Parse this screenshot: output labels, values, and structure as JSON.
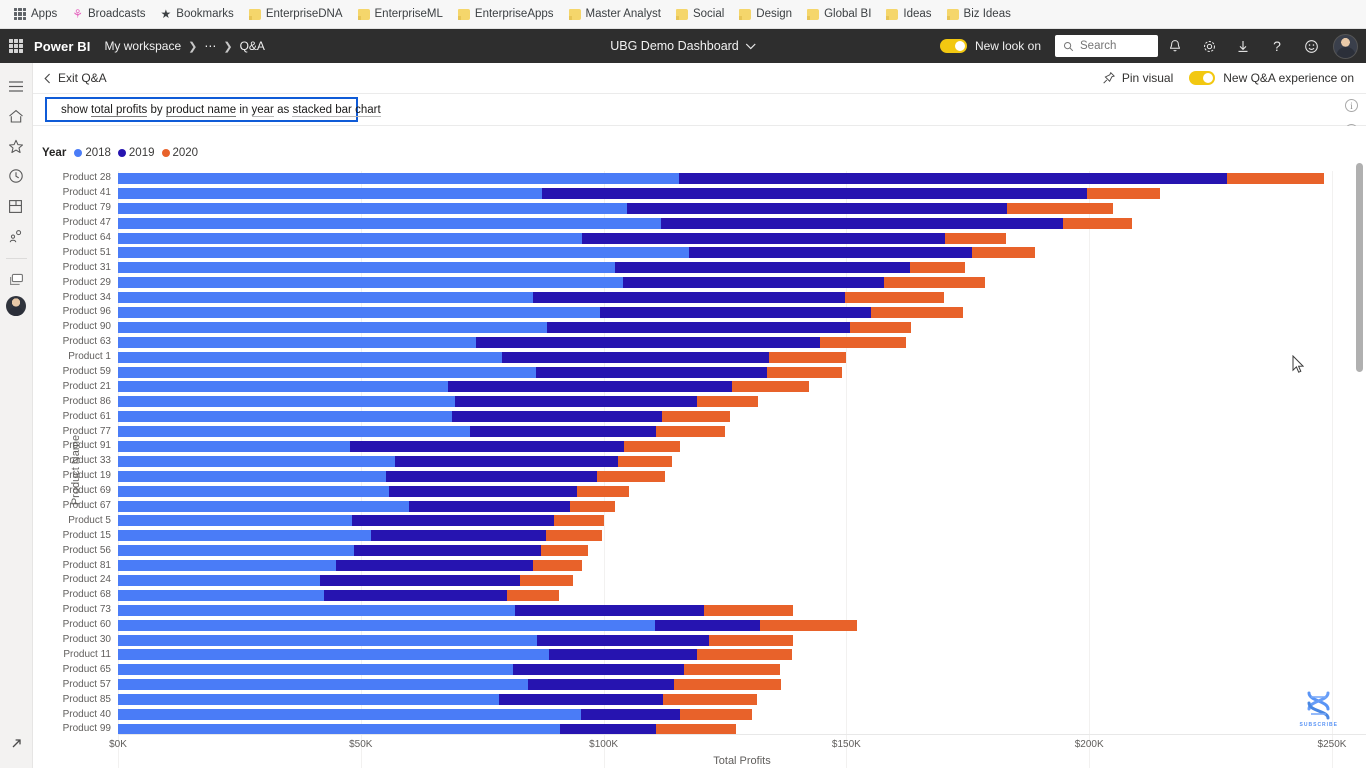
{
  "browser": {
    "bookmarks": [
      {
        "label": "Apps",
        "icon": "apps-grid-icon"
      },
      {
        "label": "Broadcasts",
        "icon": "broadcast-icon"
      },
      {
        "label": "Bookmarks",
        "icon": "star-icon"
      },
      {
        "label": "EnterpriseDNA",
        "icon": "folder-icon"
      },
      {
        "label": "EnterpriseML",
        "icon": "folder-icon"
      },
      {
        "label": "EnterpriseApps",
        "icon": "folder-icon"
      },
      {
        "label": "Master Analyst",
        "icon": "folder-icon"
      },
      {
        "label": "Social",
        "icon": "folder-icon"
      },
      {
        "label": "Design",
        "icon": "folder-icon"
      },
      {
        "label": "Global BI",
        "icon": "folder-icon"
      },
      {
        "label": "Ideas",
        "icon": "folder-icon"
      },
      {
        "label": "Biz Ideas",
        "icon": "folder-icon"
      }
    ]
  },
  "topnav": {
    "brand": "Power BI",
    "breadcrumb": [
      "My workspace",
      "⋯",
      "Q&A"
    ],
    "report_title": "UBG Demo Dashboard",
    "new_look_toggle": "New look on",
    "search_placeholder": "Search",
    "icons": [
      "bell-icon",
      "gear-icon",
      "download-icon",
      "help-icon",
      "feedback-icon",
      "avatar"
    ]
  },
  "rail": {
    "items": [
      {
        "name": "hamburger-menu",
        "label": "Navigation"
      },
      {
        "name": "home-icon",
        "label": "Home"
      },
      {
        "name": "favorites-star-icon",
        "label": "Favorites"
      },
      {
        "name": "recent-clock-icon",
        "label": "Recent"
      },
      {
        "name": "apps-icon",
        "label": "Apps"
      },
      {
        "name": "shared-with-me-icon",
        "label": "Shared with me"
      },
      {
        "name": "workspaces-icon",
        "label": "Workspaces"
      },
      {
        "name": "my-workspace-avatar",
        "label": "My workspace"
      }
    ],
    "bottom": {
      "name": "expand-icon",
      "label": "Expand"
    }
  },
  "qa_header": {
    "exit_label": "Exit Q&A",
    "pin_visual_label": "Pin visual",
    "experience_toggle_label": "New Q&A experience on"
  },
  "query": {
    "tokens": [
      {
        "t": "show ",
        "style": "plain"
      },
      {
        "t": "total profits",
        "style": "ul-strong"
      },
      {
        "t": " by ",
        "style": "plain"
      },
      {
        "t": "product name",
        "style": "ul-strong"
      },
      {
        "t": " in ",
        "style": "plain"
      },
      {
        "t": "year",
        "style": "ul"
      },
      {
        "t": " as ",
        "style": "plain"
      },
      {
        "t": "stacked bar chart",
        "style": "ul"
      }
    ],
    "full_text": "show total profits by product name in year as stacked bar chart",
    "icon": "question-bubble-icon"
  },
  "watermark": {
    "text": "SUBSCRIBE",
    "icon": "dna-helix-icon"
  },
  "chart_data": {
    "type": "bar",
    "orientation": "horizontal",
    "stacked": true,
    "title": "",
    "xlabel": "Total Profits",
    "ylabel": "Product Name",
    "legend_title": "Year",
    "legend_position": "top-left",
    "grid": true,
    "xlim": [
      0,
      250000
    ],
    "xticks": [
      0,
      50000,
      100000,
      150000,
      200000,
      250000
    ],
    "xticklabels": [
      "$0K",
      "$50K",
      "$100K",
      "$150K",
      "$200K",
      "$250K"
    ],
    "colors": {
      "2018": "#4a7cf7",
      "2019": "#2614b0",
      "2020": "#e8622a"
    },
    "series_names": [
      "2018",
      "2019",
      "2020"
    ],
    "categories": [
      "Product 28",
      "Product 41",
      "Product 79",
      "Product 47",
      "Product 64",
      "Product 51",
      "Product 31",
      "Product 29",
      "Product 34",
      "Product 96",
      "Product 90",
      "Product 63",
      "Product 1",
      "Product 59",
      "Product 21",
      "Product 86",
      "Product 61",
      "Product 77",
      "Product 91",
      "Product 33",
      "Product 19",
      "Product 69",
      "Product 67",
      "Product 5",
      "Product 15",
      "Product 56",
      "Product 81",
      "Product 24",
      "Product 68",
      "Product 73",
      "Product 60",
      "Product 30",
      "Product 11",
      "Product 65",
      "Product 57",
      "Product 85",
      "Product 40",
      "Product 99"
    ],
    "series": [
      {
        "name": "2018",
        "values": [
          115600,
          87300,
          104800,
          111800,
          95600,
          117500,
          102300,
          104000,
          85500,
          99300,
          88300,
          73800,
          79000,
          86000,
          68000,
          69300,
          68800,
          72400,
          47800,
          57000,
          55200,
          55800,
          60000,
          48200,
          52200,
          48700,
          44800,
          41500,
          42500,
          81800,
          110500,
          86200,
          88700,
          81300,
          84500,
          78400,
          95300,
          91100
        ]
      },
      {
        "name": "2019",
        "values": [
          112800,
          112200,
          78200,
          82900,
          74700,
          58400,
          60900,
          53800,
          64200,
          55800,
          62500,
          70700,
          55000,
          47700,
          58500,
          50000,
          43200,
          38300,
          56500,
          45900,
          43500,
          38800,
          33100,
          41500,
          36000,
          38400,
          40700,
          41300,
          37600,
          38800,
          21800,
          35500,
          30500,
          35200,
          30000,
          33800,
          20400,
          19600
        ]
      },
      {
        "name": "2020",
        "values": [
          19900,
          15000,
          21800,
          14100,
          12500,
          12900,
          11200,
          20700,
          20500,
          19000,
          12500,
          17700,
          15900,
          15300,
          15700,
          12600,
          14000,
          14300,
          11500,
          11200,
          14000,
          10600,
          9300,
          10300,
          11500,
          9700,
          10000,
          10800,
          10800,
          18400,
          19800,
          17300,
          19500,
          19900,
          22000,
          19300,
          14900,
          16500
        ]
      }
    ]
  }
}
